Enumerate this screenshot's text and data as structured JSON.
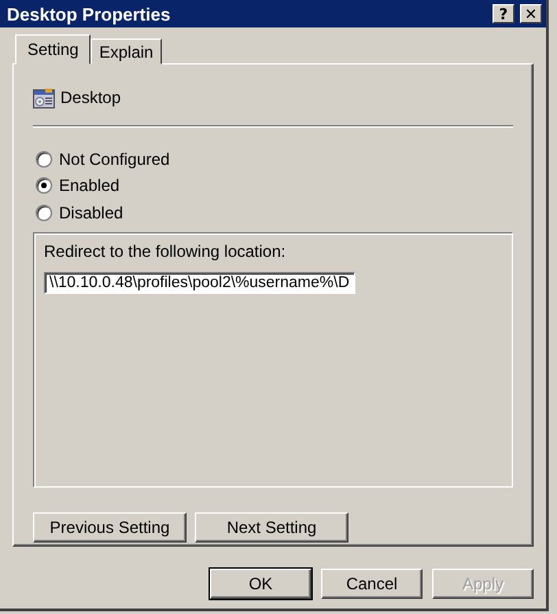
{
  "window": {
    "title": "Desktop Properties",
    "title_buttons": [
      "?",
      "✕"
    ]
  },
  "tabs": [
    {
      "label": "Setting",
      "selected": true
    },
    {
      "label": "Explain",
      "selected": false
    }
  ],
  "policy": {
    "name": "Desktop"
  },
  "options": [
    {
      "label": "Not Configured",
      "selected": false
    },
    {
      "label": "Enabled",
      "selected": true
    },
    {
      "label": "Disabled",
      "selected": false
    }
  ],
  "group": {
    "label": "Redirect to the following location:",
    "value": "\\\\10.10.0.48\\profiles\\pool2\\%username%\\D"
  },
  "nav_buttons": [
    {
      "label": "Previous Setting",
      "disabled": false
    },
    {
      "label": "Next Setting",
      "disabled": false
    }
  ],
  "buttons": [
    {
      "label": "OK",
      "default": true,
      "disabled": false
    },
    {
      "label": "Cancel",
      "default": false,
      "disabled": false
    },
    {
      "label": "Apply",
      "default": false,
      "disabled": true
    }
  ]
}
